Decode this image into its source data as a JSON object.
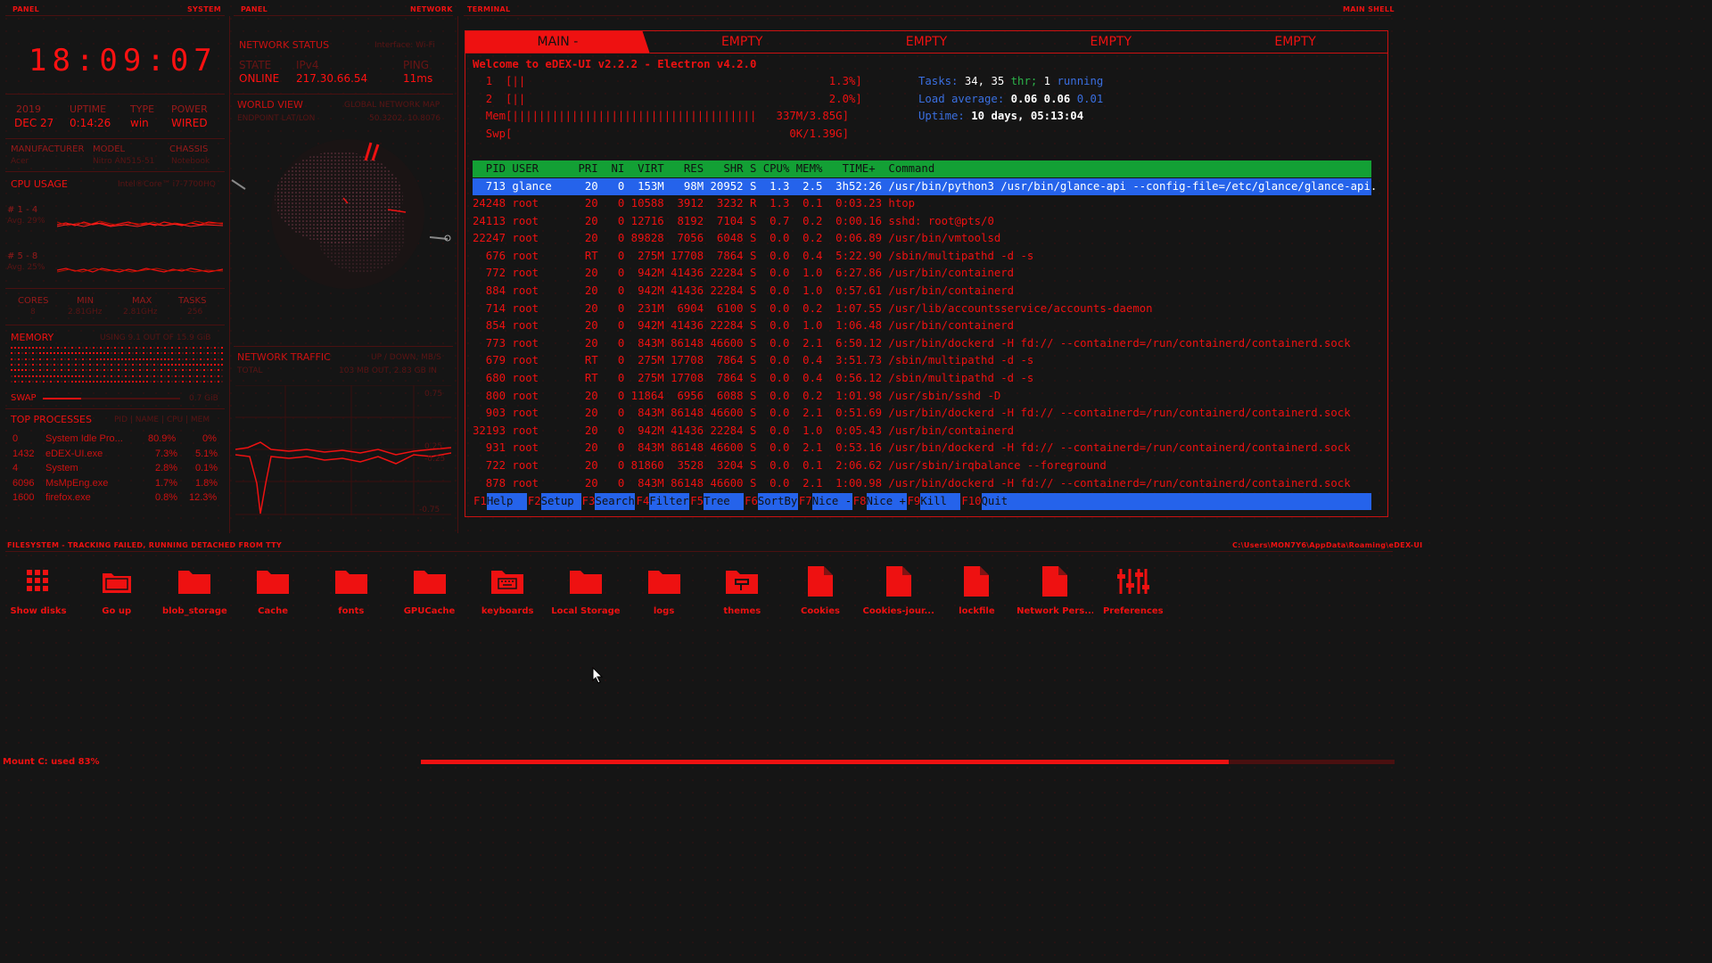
{
  "panels": {
    "left_label": "PANEL",
    "left_title": "SYSTEM",
    "mid_label": "PANEL",
    "mid_title": "NETWORK",
    "term_label": "TERMINAL",
    "term_title": "MAIN SHELL"
  },
  "clock": "18:09:07",
  "sysinfo": {
    "year": "2019",
    "date": "DEC 27",
    "uptime_label": "UPTIME",
    "uptime": "0:14:26",
    "type_label": "TYPE",
    "type": "win",
    "power_label": "POWER",
    "power": "WIRED"
  },
  "hardware": {
    "manufacturer_label": "MANUFACTURER",
    "manufacturer": "Acer",
    "model_label": "MODEL",
    "model": "Nitro AN515-51",
    "chassis_label": "CHASSIS",
    "chassis": "Notebook"
  },
  "cpu": {
    "title": "CPU USAGE",
    "name": "Intel®Core™ i7-7700HQ",
    "g1_label": "# 1 - 4",
    "g1_avg": "Avg. 29%",
    "g2_label": "# 5 - 8",
    "g2_avg": "Avg. 25%",
    "cores_label": "CORES",
    "cores": "8",
    "min_label": "MIN",
    "min": "2.81GHz",
    "max_label": "MAX",
    "max": "2.81GHz",
    "tasks_label": "TASKS",
    "tasks": "256"
  },
  "memory": {
    "title": "MEMORY",
    "info": "USING 9.1 OUT OF 15.9 GiB",
    "swap_label": "SWAP",
    "swap": "0.7 GiB"
  },
  "top": {
    "title": "TOP PROCESSES",
    "cols": "PID | NAME | CPU | MEM",
    "rows": [
      [
        "0",
        "System Idle Pro...",
        "80.9%",
        "0%"
      ],
      [
        "1432",
        "eDEX-UI.exe",
        "7.3%",
        "5.1%"
      ],
      [
        "4",
        "System",
        "2.8%",
        "0.1%"
      ],
      [
        "6096",
        "MsMpEng.exe",
        "1.7%",
        "1.8%"
      ],
      [
        "1600",
        "firefox.exe",
        "0.8%",
        "12.3%"
      ]
    ]
  },
  "network": {
    "status_title": "NETWORK STATUS",
    "iface": "Interface: Wi-Fi",
    "state_label": "STATE",
    "state": "ONLINE",
    "ipv4_label": "IPv4",
    "ipv4": "217.30.66.54",
    "ping_label": "PING",
    "ping": "11ms",
    "world_title": "WORLD VIEW",
    "world_sub": "GLOBAL NETWORK MAP",
    "endpoint_label": "ENDPOINT LAT/LON",
    "endpoint": "50.3202, 10.8076",
    "traffic_title": "NETWORK TRAFFIC",
    "traffic_sub": "UP / DOWN, MB/S",
    "total_label": "TOTAL",
    "total": "103 MB OUT, 2.83 GB IN",
    "y_top": "0.75",
    "y_mid_up": "0.25",
    "y_mid_down": "-0.25",
    "y_bot": "-0.75"
  },
  "tabs": [
    "MAIN -",
    "EMPTY",
    "EMPTY",
    "EMPTY",
    "EMPTY"
  ],
  "terminal": {
    "welcome": "Welcome to eDEX-UI v2.2.2 - Electron v4.2.0",
    "cpu1": "  1  [||                                              1.3%]",
    "cpu2": "  2  [||                                              2.0%]",
    "mem": "  Mem[|||||||||||||||||||||||||||||||||||||   337M/3.85G]",
    "swp": "  Swp[                                          0K/1.39G]",
    "tasks_a": "Tasks: ",
    "tasks_n": "34, 35",
    "tasks_b": " thr; ",
    "tasks_r": "1",
    "tasks_c": " running",
    "load_a": "Load average: ",
    "load_1": "0.06 0.06",
    "load_2": " 0.01",
    "up_a": "Uptime: ",
    "up_v": "10 days, 05:13:04",
    "header": "  PID USER      PRI  NI  VIRT   RES   SHR S CPU% MEM%   TIME+  Command",
    "selected": "  713 glance     20   0  153M   98M 20952 S  1.3  2.5  3h52:26 /usr/bin/python3 /usr/bin/glance-api --config-file=/etc/glance/glance-api.",
    "rows": [
      "24248 root       20   0 10588  3912  3232 R  1.3  0.1  0:03.23 htop",
      "24113 root       20   0 12716  8192  7104 S  0.7  0.2  0:00.16 sshd: root@pts/0",
      "22247 root       20   0 89828  7056  6048 S  0.0  0.2  0:06.89 /usr/bin/vmtoolsd",
      "  676 root       RT   0  275M 17708  7864 S  0.0  0.4  5:22.90 /sbin/multipathd -d -s",
      "  772 root       20   0  942M 41436 22284 S  0.0  1.0  6:27.86 /usr/bin/containerd",
      "  884 root       20   0  942M 41436 22284 S  0.0  1.0  0:57.61 /usr/bin/containerd",
      "  714 root       20   0  231M  6904  6100 S  0.0  0.2  1:07.55 /usr/lib/accountsservice/accounts-daemon",
      "  854 root       20   0  942M 41436 22284 S  0.0  1.0  1:06.48 /usr/bin/containerd",
      "  773 root       20   0  843M 86148 46600 S  0.0  2.1  6:50.12 /usr/bin/dockerd -H fd:// --containerd=/run/containerd/containerd.sock",
      "  679 root       RT   0  275M 17708  7864 S  0.0  0.4  3:51.73 /sbin/multipathd -d -s",
      "  680 root       RT   0  275M 17708  7864 S  0.0  0.4  0:56.12 /sbin/multipathd -d -s",
      "  800 root       20   0 11864  6956  6088 S  0.0  0.2  1:01.98 /usr/sbin/sshd -D",
      "  903 root       20   0  843M 86148 46600 S  0.0  2.1  0:51.69 /usr/bin/dockerd -H fd:// --containerd=/run/containerd/containerd.sock",
      "32193 root       20   0  942M 41436 22284 S  0.0  1.0  0:05.43 /usr/bin/containerd",
      "  931 root       20   0  843M 86148 46600 S  0.0  2.1  0:53.16 /usr/bin/dockerd -H fd:// --containerd=/run/containerd/containerd.sock",
      "  722 root       20   0 81860  3528  3204 S  0.0  0.1  2:06.62 /usr/sbin/irqbalance --foreground",
      "  878 root       20   0  843M 86148 46600 S  0.0  2.1  1:00.98 /usr/bin/dockerd -H fd:// --containerd=/run/containerd/containerd.sock"
    ],
    "fkeys": [
      [
        "F1",
        "Help"
      ],
      [
        "F2",
        "Setup"
      ],
      [
        "F3",
        "Search"
      ],
      [
        "F4",
        "Filter"
      ],
      [
        "F5",
        "Tree"
      ],
      [
        "F6",
        "SortBy"
      ],
      [
        "F7",
        "Nice -"
      ],
      [
        "F8",
        "Nice +"
      ],
      [
        "F9",
        "Kill"
      ],
      [
        "F10",
        "Quit"
      ]
    ]
  },
  "filesystem": {
    "status": "FILESYSTEM - TRACKING FAILED, RUNNING DETACHED FROM TTY",
    "path": "C:\\Users\\MON7Y6\\AppData\\Roaming\\eDEX-UI",
    "items": [
      {
        "name": "Show disks",
        "icon": "grid-icon"
      },
      {
        "name": "Go up",
        "icon": "folder-up-icon"
      },
      {
        "name": "blob_storage",
        "icon": "folder-icon"
      },
      {
        "name": "Cache",
        "icon": "folder-icon"
      },
      {
        "name": "fonts",
        "icon": "folder-icon"
      },
      {
        "name": "GPUCache",
        "icon": "folder-icon"
      },
      {
        "name": "keyboards",
        "icon": "keyboard-folder-icon"
      },
      {
        "name": "Local Storage",
        "icon": "folder-icon"
      },
      {
        "name": "logs",
        "icon": "folder-icon"
      },
      {
        "name": "themes",
        "icon": "themes-folder-icon"
      },
      {
        "name": "Cookies",
        "icon": "file-icon"
      },
      {
        "name": "Cookies-jour...",
        "icon": "file-icon"
      },
      {
        "name": "lockfile",
        "icon": "file-icon"
      },
      {
        "name": "Network Pers...",
        "icon": "file-icon"
      },
      {
        "name": "Preferences",
        "icon": "settings-file-icon"
      }
    ]
  },
  "disk": {
    "label": "Mount C: used 83%",
    "used_fraction": 0.83
  },
  "colors": {
    "accent": "#e11111",
    "background": "#151515",
    "htop_header": "#13a035",
    "htop_select": "#2563eb"
  }
}
